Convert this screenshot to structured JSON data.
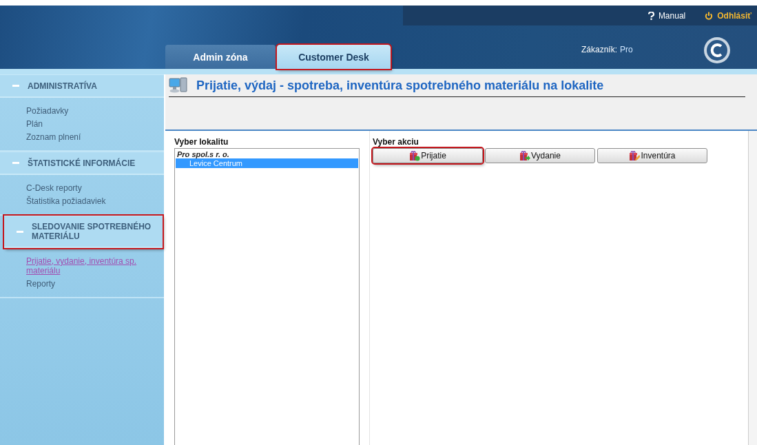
{
  "header": {
    "links": [
      {
        "kind": "help",
        "label": "Manual"
      },
      {
        "kind": "logout",
        "label": "Odhlásiť"
      }
    ],
    "customer_label": "Zákazník:",
    "customer_value": "Pro"
  },
  "tabs": [
    {
      "label": "Admin zóna",
      "selected": false,
      "highlighted": false
    },
    {
      "label": "Customer Desk",
      "selected": true,
      "highlighted": true
    }
  ],
  "sidebar": {
    "sections": [
      {
        "title": "ADMINISTRATÍVA",
        "expanded": true,
        "highlighted": false,
        "items": [
          {
            "label": "Požiadavky",
            "selected": false
          },
          {
            "label": "Plán",
            "selected": false
          },
          {
            "label": "Zoznam plnení",
            "selected": false
          }
        ]
      },
      {
        "title": "ŠTATISTICKÉ INFORMÁCIE",
        "expanded": true,
        "highlighted": false,
        "items": [
          {
            "label": "C-Desk reporty",
            "selected": false
          },
          {
            "label": "Štatistika požiadaviek",
            "selected": false
          }
        ]
      },
      {
        "title": "SLEDOVANIE SPOTREBNÉHO MATERIÁLU",
        "expanded": true,
        "highlighted": true,
        "items": [
          {
            "label": "Prijatie, vydanie, inventúra sp. materiálu",
            "selected": true
          },
          {
            "label": "Reporty",
            "selected": false
          }
        ]
      }
    ]
  },
  "page": {
    "title": "Prijatie, výdaj - spotreba, inventúra spotrebného materiálu na lokalite"
  },
  "location_panel": {
    "label": "Vyber lokalitu",
    "tree": [
      {
        "label": "Pro spol.s r. o.",
        "selected": false,
        "children": [
          {
            "label": "Levice Centrum",
            "selected": true
          }
        ]
      }
    ]
  },
  "action_panel": {
    "label": "Vyber akciu",
    "buttons": [
      {
        "label": "Prijatie",
        "kind": "receive",
        "highlighted": true
      },
      {
        "label": "Vydanie",
        "kind": "issue",
        "highlighted": false
      },
      {
        "label": "Inventúra",
        "kind": "inventory",
        "highlighted": false
      }
    ]
  }
}
